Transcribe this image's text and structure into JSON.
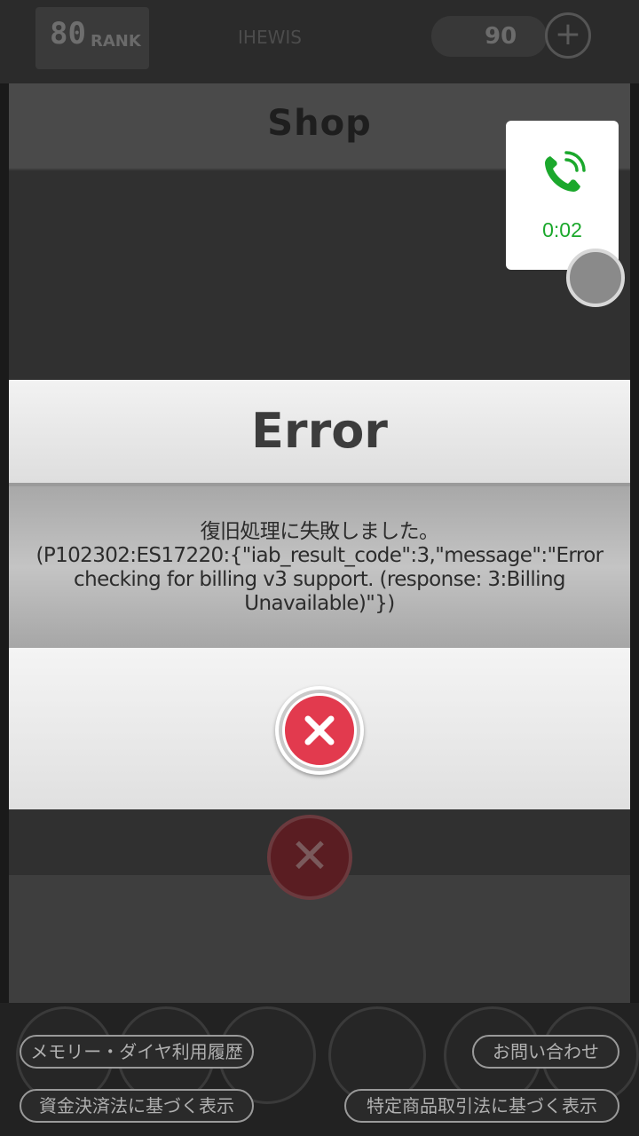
{
  "game_bar": {
    "rank_value": "80",
    "rank_label": "RANK",
    "center_text": "IHEWIS",
    "currency_value": "90",
    "plus_symbol": "+"
  },
  "shop": {
    "title": "Shop"
  },
  "dialog": {
    "title": "Error",
    "message_line1": "復旧処理に失敗しました。",
    "message_line2": "(P102302:ES17220:{\"iab_result_code\":3,\"message\":\"Error",
    "message_line3": "checking for billing v3 support. (response: 3:Billing",
    "message_line4": "Unavailable)\"})",
    "close_icon": "close-x-icon"
  },
  "call_overlay": {
    "icon": "phone-icon",
    "duration": "0:02",
    "accent_color": "#1ba82c"
  },
  "footer_links": {
    "memory_history": "メモリー・ダイヤ利用履歴",
    "contact": "お問い合わせ",
    "payment_act": "資金決済法に基づく表示",
    "commercial_act": "特定商品取引法に基づく表示"
  },
  "colors": {
    "close_button_red": "#e23a4e",
    "dialog_header": "#eeeeee",
    "dialog_body": "#b8b8b8"
  }
}
